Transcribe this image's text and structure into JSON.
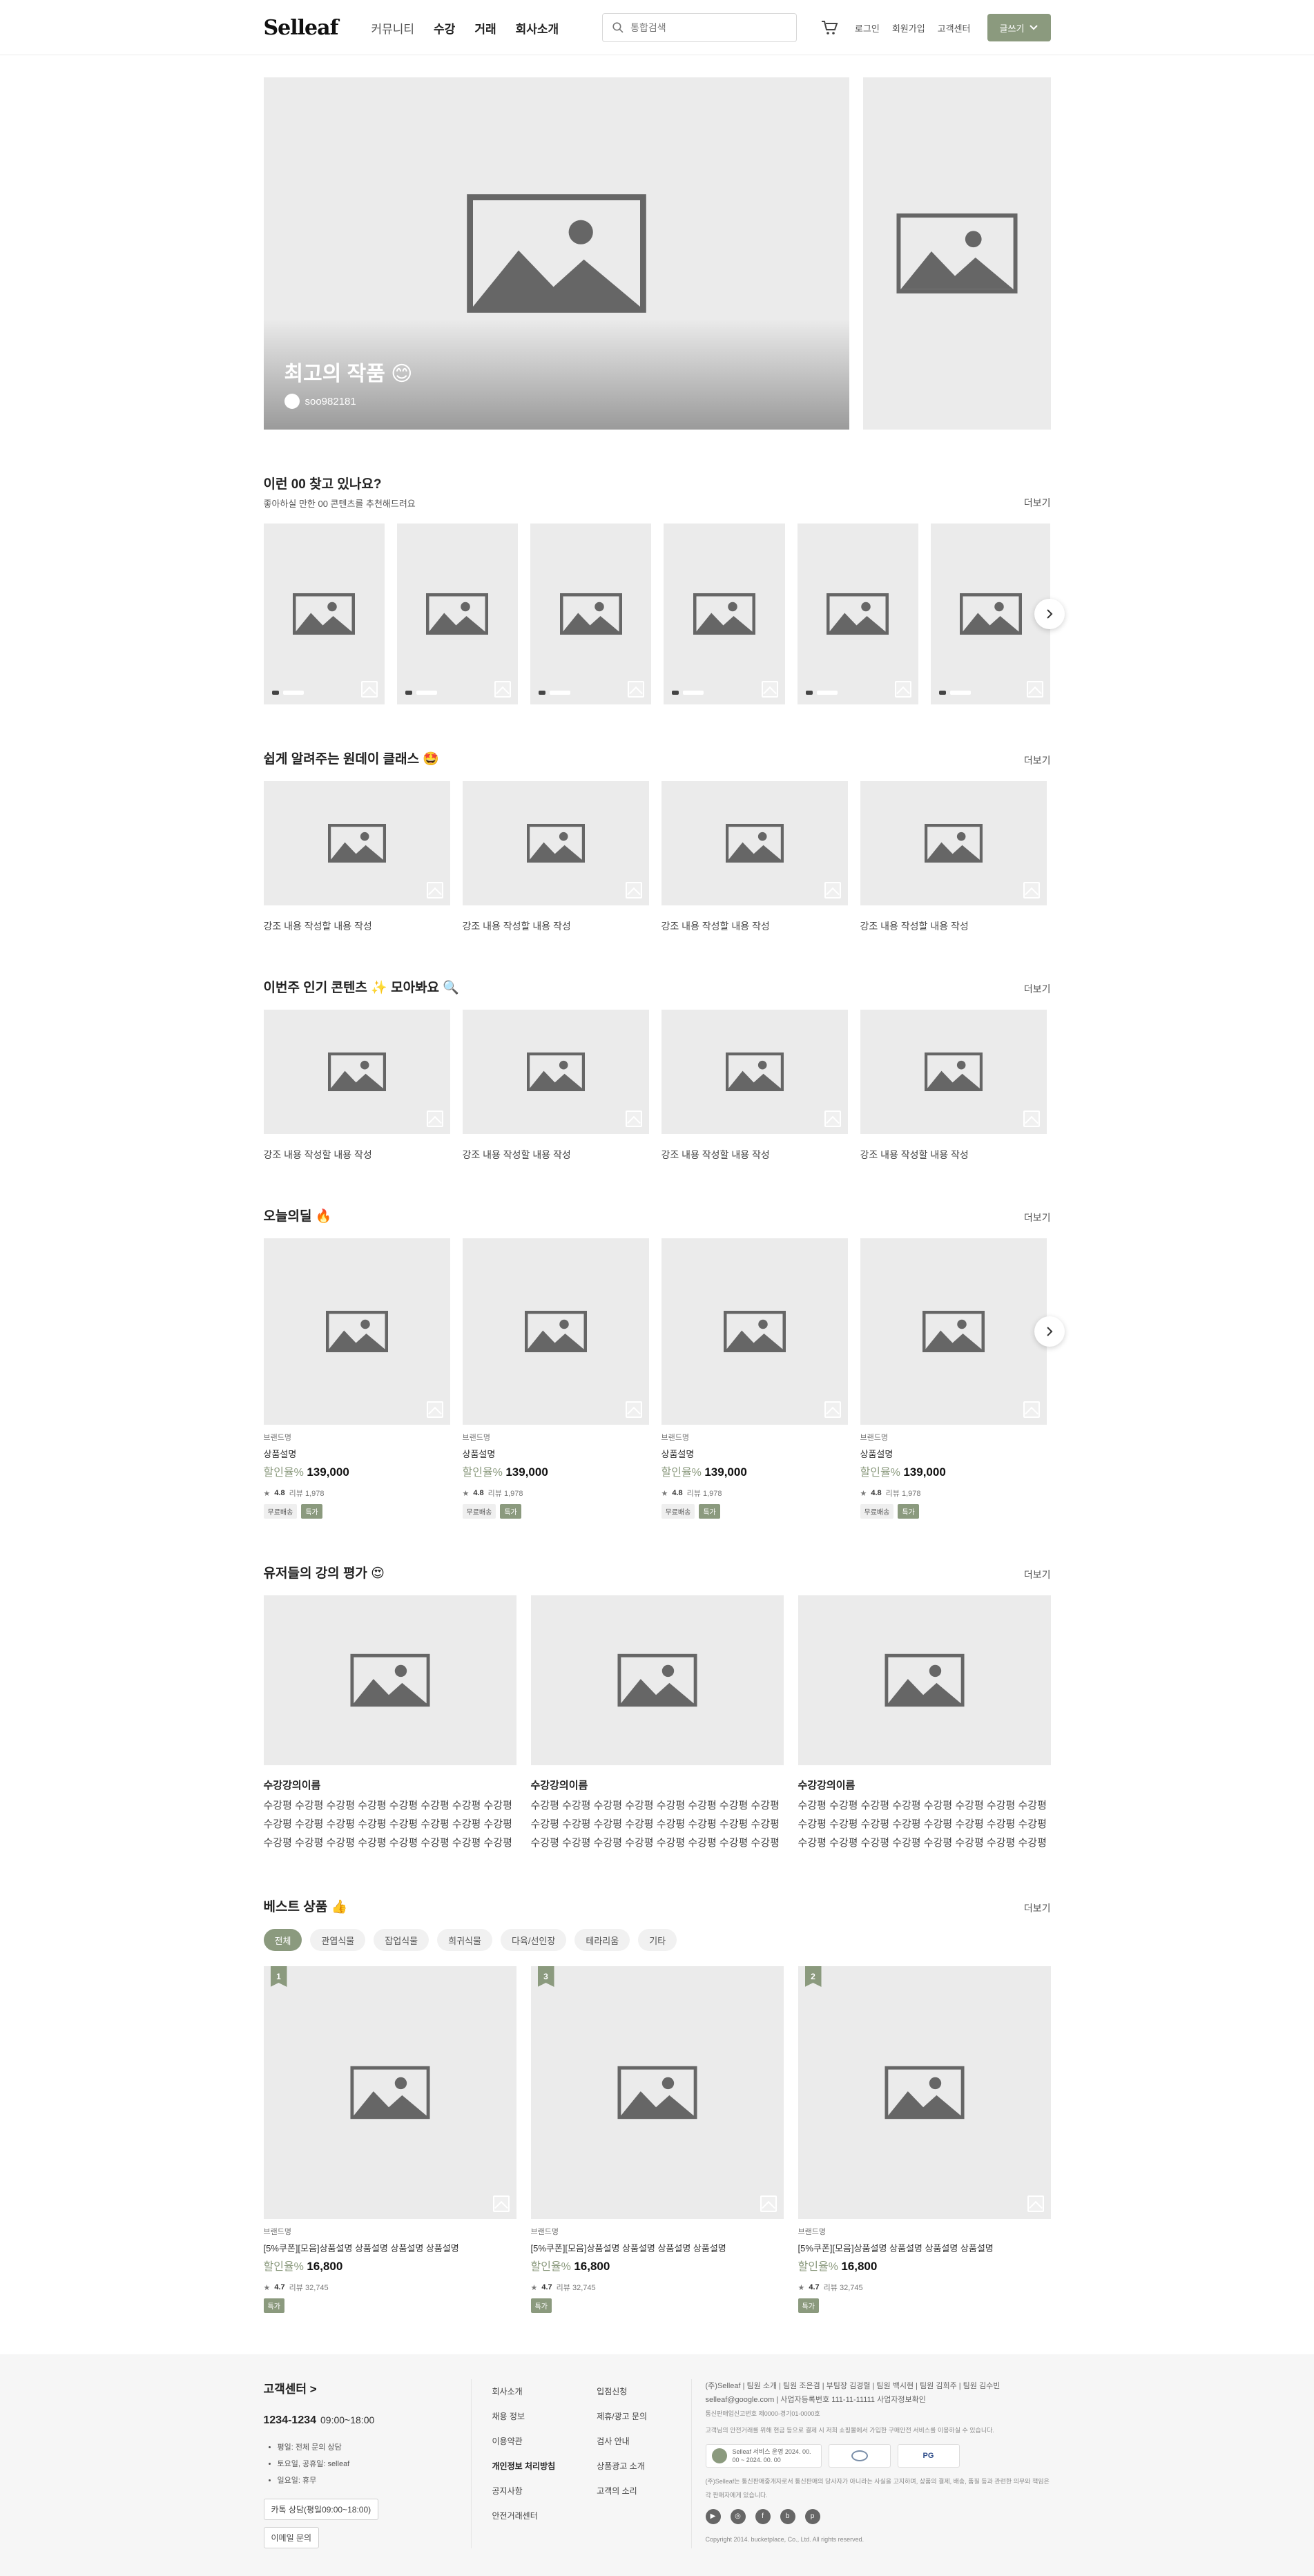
{
  "header": {
    "logo": "Selleaf",
    "nav": [
      "커뮤니티",
      "수강",
      "거래",
      "회사소개"
    ],
    "search_placeholder": "통합검색",
    "links": [
      "로그인",
      "회원가입",
      "고객센터"
    ],
    "write_label": "글쓰기"
  },
  "hero": {
    "title": "최고의 작품 😊",
    "user": "soo982181"
  },
  "sections": {
    "find": {
      "title": "이런 00 찾고 있나요?",
      "subtitle": "좋아하실 만한 00 콘텐츠를 추천해드려요",
      "more": "더보기"
    },
    "oneday": {
      "title": "쉽게 알려주는 원데이 클래스 🤩",
      "more": "더보기",
      "caption": "강조 내용 작성할 내용 작성"
    },
    "popular": {
      "title": "이번주 인기 콘텐츠 ✨ 모아봐요 🔍",
      "more": "더보기",
      "caption": "강조 내용 작성할 내용 작성"
    },
    "deal": {
      "title": "오늘의딜 🔥",
      "more": "더보기"
    },
    "reviews": {
      "title": "유저들의 강의 평가 😍",
      "more": "더보기"
    },
    "best": {
      "title": "베스트 상품 👍",
      "more": "더보기"
    }
  },
  "deal_item": {
    "brand": "브랜드명",
    "name": "상품설명",
    "discount": "할인율%",
    "price": "139,000",
    "rating": "4.8",
    "reviews": "리뷰 1,978",
    "tag1": "무료배송",
    "tag2": "특가"
  },
  "review_item": {
    "title": "수강강의이름",
    "body": "수강평 수강평 수강평 수강평 수강평 수강평 수강평 수강평 수강평 수강평 수강평 수강평 수강평 수강평 수강평 수강평 수강평 수강평 수강평 수강평 수강평 수강평 수강평 수강평 수강평 수강평..."
  },
  "best_filters": [
    "전체",
    "관엽식물",
    "잡업식물",
    "희귀식물",
    "다육/선인장",
    "테라리움",
    "기타"
  ],
  "best_items": [
    {
      "rank": "1"
    },
    {
      "rank": "3"
    },
    {
      "rank": "2"
    }
  ],
  "best_item": {
    "brand": "브랜드명",
    "name": "[5%쿠폰][모음]상품설명 상품설명 상품설명 상품설명",
    "discount": "할인율%",
    "price": "16,800",
    "rating": "4.7",
    "reviews": "리뷰 32,745",
    "tag": "특가"
  },
  "footer": {
    "cs_title": "고객센터 >",
    "phone": "1234-1234",
    "hours": "09:00~18:00",
    "notes": [
      "평일: 전체 문의 상담",
      "토요일, 공휴일: selleaf",
      "일요일: 휴무"
    ],
    "kakao": "카톡 상담(평일09:00~18:00)",
    "email_btn": "이메일 문의",
    "col1": [
      "회사소개",
      "채용 정보",
      "이용약관",
      "개인정보 처리방침",
      "공지사항",
      "안전거래센터"
    ],
    "col2": [
      "입점신청",
      "제휴/광고 문의",
      "검사 안내",
      "상품광고 소개",
      "고객의 소리"
    ],
    "company_links": "(주)Selleaf | 팀원 소개 | 팀원 조은겸 | 부팀장 김경렬 | 팀원 백시현 | 팀원 김희주 | 팀원 김수빈",
    "email": "selleaf@google.com | 사업자등록번호 111-11-11111 사업자정보확인",
    "report": "통신판매업신고번호 제0000-경기01-0000호",
    "notice": "고객님의 안전거래를 위해 현금 등으로 결제 시 저희 쇼핑몰에서 가입한 구매안전 서비스를 이용하실 수 있습니다.",
    "badge1": "Selleaf 서비스 운영 2024. 00. 00 ~ 2024. 00. 00",
    "disclaimer": "(주)Selleaf는 통신판매중개자로서 통신판매의 당사자가 아니라는 사실을 고지하며, 상품의 결제, 배송, 품질 등과 관련한 의무와 책임은 각 판매자에게 있습니다.",
    "socials": [
      "▶",
      "◎",
      "f",
      "b",
      "p"
    ],
    "copyright": "Copyright 2014. bucketplace, Co., Ltd. All rights reserved."
  },
  "colors": {
    "accent": "#8b9a7e",
    "placeholder": "#ebebeb"
  },
  "icons": [
    "search-icon",
    "cart-icon",
    "chevron-down-icon",
    "image-placeholder-icon",
    "bookmark-icon",
    "chevron-right-icon"
  ]
}
